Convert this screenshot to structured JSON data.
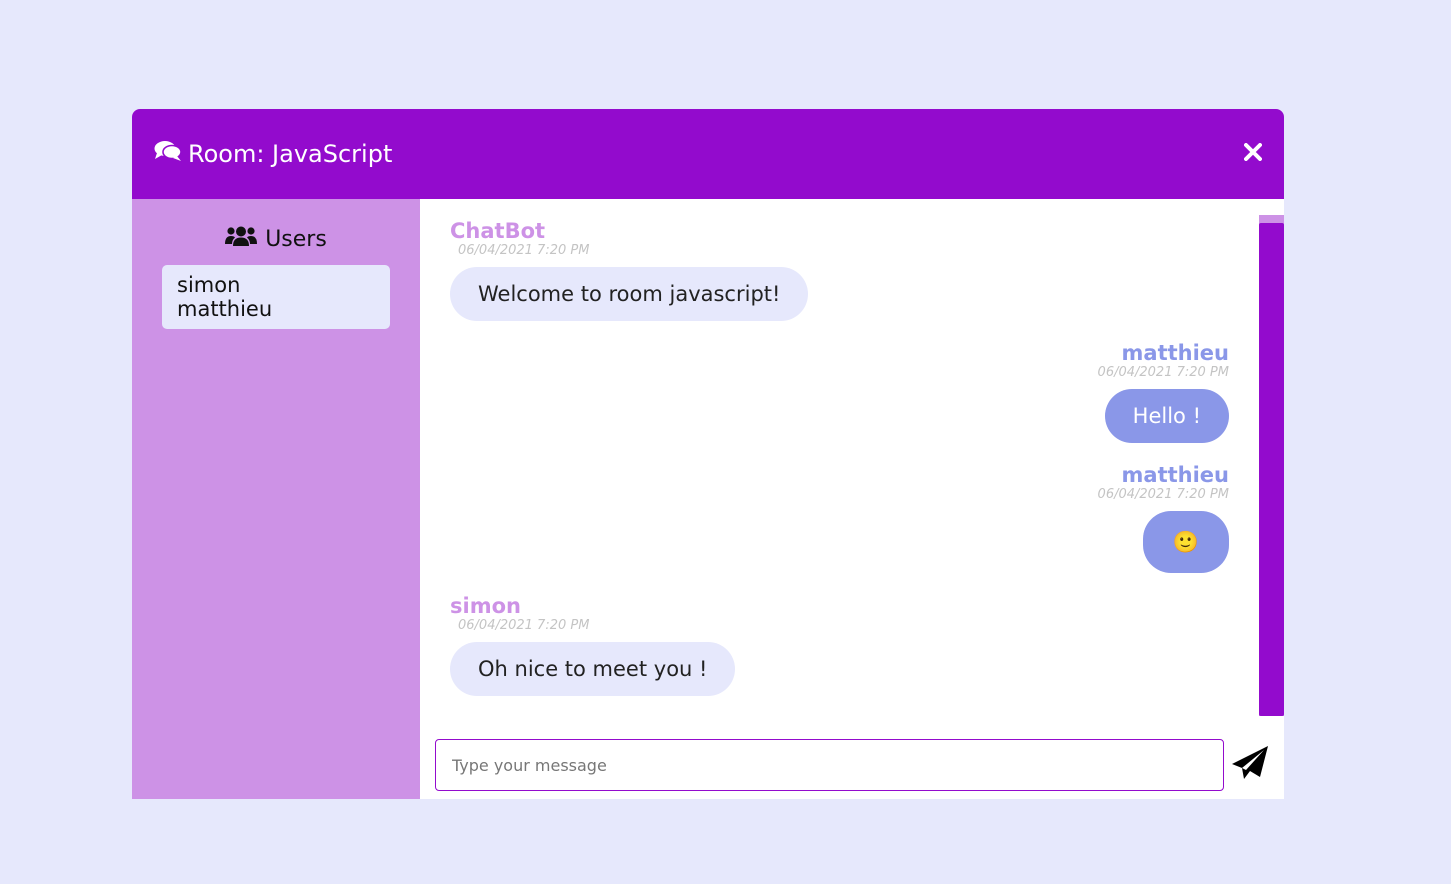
{
  "room": {
    "label": "Room: JavaScript"
  },
  "sidebar": {
    "heading": "Users",
    "users": [
      "simon",
      "matthieu"
    ]
  },
  "messages": [
    {
      "author": "ChatBot",
      "time": "06/04/2021 7:20 PM",
      "text": "Welcome to room javascript!",
      "side": "left"
    },
    {
      "author": "matthieu",
      "time": "06/04/2021 7:20 PM",
      "text": "Hello !",
      "side": "right"
    },
    {
      "author": "matthieu",
      "time": "06/04/2021 7:20 PM",
      "text": "🙂",
      "side": "right"
    },
    {
      "author": "simon",
      "time": "06/04/2021 7:20 PM",
      "text": "Oh nice to meet you !",
      "side": "left"
    }
  ],
  "composer": {
    "placeholder": "Type your message",
    "value": ""
  },
  "icons": {
    "room": "comments-icon",
    "close": "close-icon",
    "users": "users-icon",
    "send": "paper-plane-icon"
  },
  "colors": {
    "accent": "#930bcd",
    "sidebar": "#cd92e6",
    "self_bubble": "#8a97e8",
    "other_bubble": "#e6e8fc",
    "page_bg": "#e6e8fc"
  }
}
